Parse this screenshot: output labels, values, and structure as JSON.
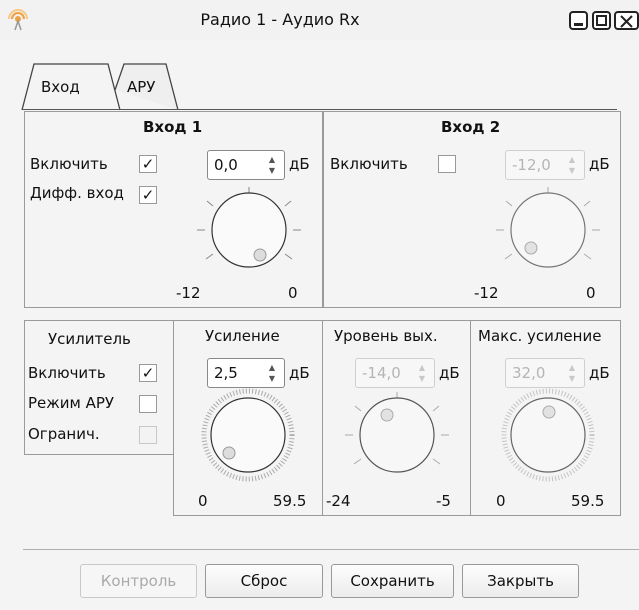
{
  "window": {
    "title": "Радио 1 - Аудио Rx"
  },
  "tabs": [
    {
      "label": "Вход"
    },
    {
      "label": "АРУ"
    }
  ],
  "input1": {
    "title": "Вход 1",
    "enable_label": "Включить",
    "enable_checked": "✓",
    "diff_label": "Дифф. вход",
    "diff_checked": "✓",
    "value": "0,0",
    "unit": "дБ",
    "min": "-12",
    "max": "0"
  },
  "input2": {
    "title": "Вход 2",
    "enable_label": "Включить",
    "value": "-12,0",
    "unit": "дБ",
    "min": "-12",
    "max": "0"
  },
  "amplifier": {
    "title": "Усилитель",
    "enable_label": "Включить",
    "enable_checked": "✓",
    "agc_label": "Режим АРУ",
    "limit_label": "Огранич."
  },
  "gain": {
    "title": "Усиление",
    "value": "2,5",
    "unit": "дБ",
    "min": "0",
    "max": "59.5"
  },
  "out_level": {
    "title": "Уровень вых.",
    "value": "-14,0",
    "unit": "дБ",
    "min": "-24",
    "max": "-5"
  },
  "max_gain": {
    "title": "Макс. усиление",
    "value": "32,0",
    "unit": "дБ",
    "min": "0",
    "max": "59.5"
  },
  "buttons": {
    "control": "Контроль",
    "reset": "Сброс",
    "save": "Сохранить",
    "close": "Закрыть"
  },
  "colors": {
    "disabled_text": "#b5b5b5",
    "frame": "#9a9a9a"
  }
}
